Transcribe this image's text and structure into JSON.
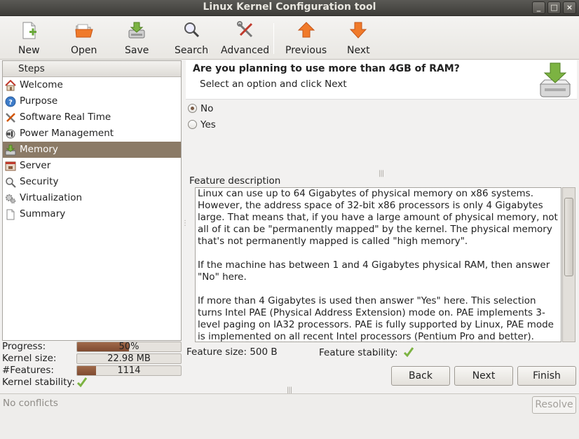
{
  "window": {
    "title": "Linux Kernel Configuration tool"
  },
  "toolbar": {
    "new": "New",
    "open": "Open",
    "save": "Save",
    "search": "Search",
    "advanced": "Advanced",
    "previous": "Previous",
    "next": "Next"
  },
  "steps": {
    "header": "Steps",
    "items": [
      {
        "label": "Welcome",
        "icon": "home-icon"
      },
      {
        "label": "Purpose",
        "icon": "help-icon"
      },
      {
        "label": "Software Real Time",
        "icon": "tools-icon"
      },
      {
        "label": "Power Management",
        "icon": "power-plug-icon"
      },
      {
        "label": "Memory",
        "icon": "memory-download-icon"
      },
      {
        "label": "Server",
        "icon": "server-icon"
      },
      {
        "label": "Security",
        "icon": "magnifier-icon"
      },
      {
        "label": "Virtualization",
        "icon": "gears-icon"
      },
      {
        "label": "Summary",
        "icon": "document-icon"
      }
    ],
    "selected": "Memory"
  },
  "stats": {
    "progress_label": "Progress:",
    "progress_value": "50%",
    "progress_fraction": 0.5,
    "kernel_size_label": "Kernel size:",
    "kernel_size_value": "22.98 MB",
    "features_label": "#Features:",
    "features_value": "1114",
    "features_fraction": 0.18,
    "stability_label": "Kernel stability:"
  },
  "question": {
    "title": "Are you planning to use more than 4GB of RAM?",
    "subtitle": "Select an option and click Next",
    "options": [
      "No",
      "Yes"
    ],
    "selected": "No"
  },
  "feature": {
    "label": "Feature description",
    "paragraphs": [
      "Linux can use up to 64 Gigabytes of physical memory on x86 systems. However, the address space of 32-bit x86 processors is only 4 Gigabytes large. That means that, if you have a large amount of physical memory, not all of it can be \"permanently mapped\" by the kernel. The physical memory that's not permanently mapped is called \"high memory\".",
      "If the machine has between 1 and 4 Gigabytes physical RAM, then answer \"No\" here.",
      "If more than 4 Gigabytes is used then answer \"Yes\" here. This selection turns Intel PAE (Physical Address Extension) mode on. PAE implements 3-level paging on IA32 processors. PAE is fully supported by Linux, PAE mode is implemented on all recent Intel processors (Pentium Pro and better). NOTE: If"
    ],
    "size_text": "Feature size: 500 B",
    "stability_label": "Feature stability:"
  },
  "buttons": {
    "back": "Back",
    "next": "Next",
    "finish": "Finish"
  },
  "status": {
    "message": "No conflicts",
    "resolve": "Resolve"
  },
  "colors": {
    "selection": "#8b7a66",
    "progress_fill": "#8f5a3c",
    "accent_orange": "#f07a2a",
    "accent_green": "#7cb342"
  }
}
